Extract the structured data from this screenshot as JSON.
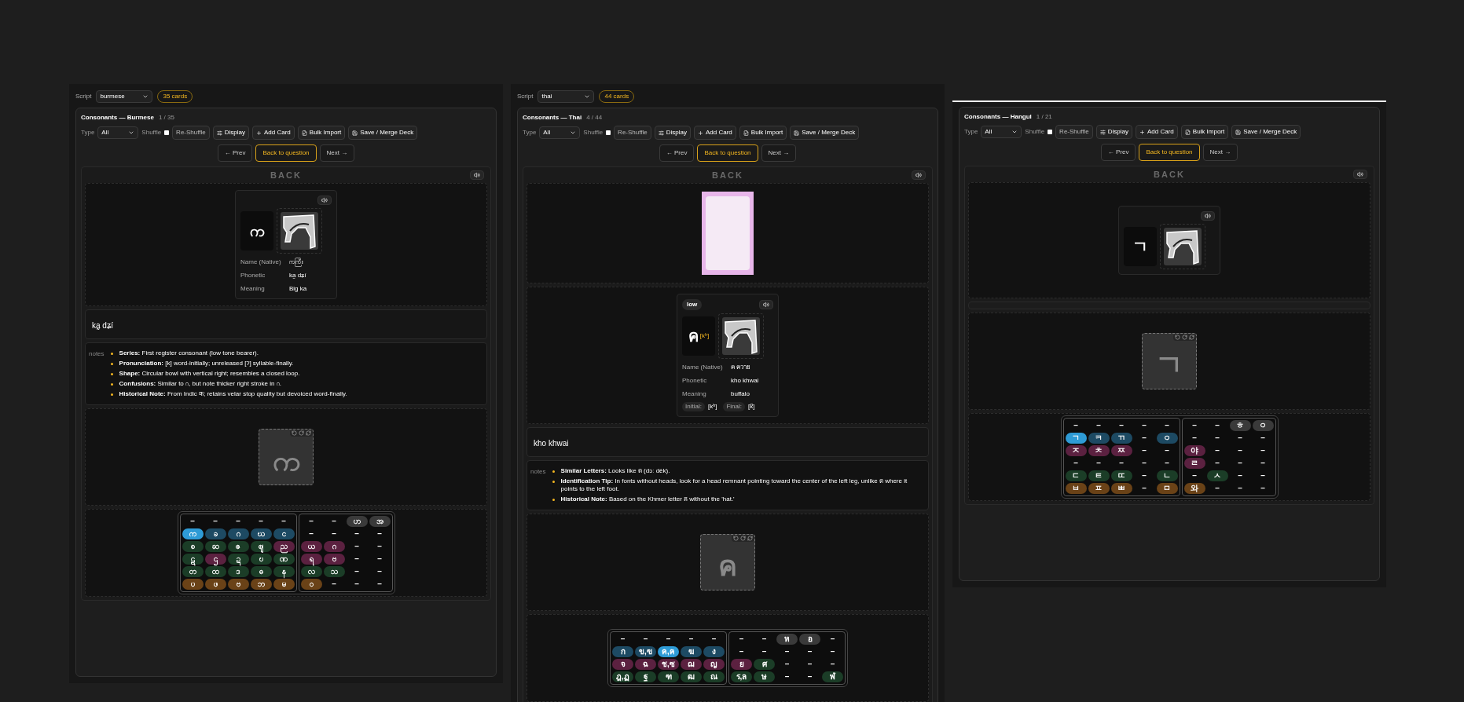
{
  "decks": [
    {
      "script": {
        "label": "Script",
        "value": "burmese",
        "count": "35 cards"
      },
      "title": "Consonants — Burmese",
      "position": "1 / 35",
      "toolbar": {
        "type_label": "Type",
        "type_value": "All",
        "shuffle_label": "Shuffle",
        "shuffle_checked": false,
        "buttons": [
          {
            "kind": "plain",
            "label": "Re-Shuffle"
          },
          {
            "kind": "display",
            "label": "Display"
          },
          {
            "kind": "add",
            "label": "Add Card"
          },
          {
            "kind": "import",
            "label": "Bulk Import"
          },
          {
            "kind": "save",
            "label": "Save / Merge Deck"
          }
        ]
      },
      "nav": [
        {
          "label": "← Prev",
          "selected": false
        },
        {
          "label": "Back to question",
          "selected": true
        },
        {
          "label": "Next →",
          "selected": false
        }
      ],
      "side_label": "BACK",
      "sections": [
        {
          "kind": "info",
          "letter": "က",
          "fields": [
            {
              "label": "Name (Native)",
              "value": "ကကြီး"
            },
            {
              "label": "Phonetic",
              "value": "ka̰ dʑí"
            },
            {
              "label": "Meaning",
              "value": "Big ka"
            }
          ]
        },
        {
          "kind": "phonetic",
          "text": "ka̰ dʑí"
        },
        {
          "kind": "notes",
          "label": "notes",
          "items": [
            "**Series:** First register consonant (low tone bearer).",
            "**Pronunciation:** [k] word-initially; unreleased [ʔ] syllable-finally.",
            "**Shape:** Circular bowl with vertical right; resembles a closed loop.",
            "**Confusions:** Similar to ဂ, but note thicker right stroke in ဂ.",
            "**Historical Note:** From Indic क; retains velar stop quality but devoiced word-finally."
          ]
        },
        {
          "kind": "trace",
          "glyph": "က"
        },
        {
          "kind": "grid",
          "groups": [
            {
              "rows": [
                [
                  {
                    "text": "–"
                  },
                  {
                    "text": "–"
                  },
                  {
                    "text": "–"
                  },
                  {
                    "text": "–"
                  },
                  {
                    "text": "–"
                  }
                ],
                [
                  {
                    "text": "က",
                    "color": "#2e9bd6"
                  },
                  {
                    "text": "ခ",
                    "color": "#1d4a63"
                  },
                  {
                    "text": "ဂ",
                    "color": "#1d4a63"
                  },
                  {
                    "text": "ဃ",
                    "color": "#1d4a63"
                  },
                  {
                    "text": "င",
                    "color": "#1d4a63"
                  }
                ],
                [
                  {
                    "text": "စ",
                    "color": "#1b3d27"
                  },
                  {
                    "text": "ဆ",
                    "color": "#1b3d27"
                  },
                  {
                    "text": "ဇ",
                    "color": "#1b3d27"
                  },
                  {
                    "text": "ဈ",
                    "color": "#1b3d27"
                  },
                  {
                    "text": "ည",
                    "color": "#5b2140"
                  }
                ],
                [
                  {
                    "text": "ဋ",
                    "color": "#1b3d27"
                  },
                  {
                    "text": "ဌ",
                    "color": "#5b2140"
                  },
                  {
                    "text": "ဍ",
                    "color": "#1b3d27"
                  },
                  {
                    "text": "ဎ",
                    "color": "#1b3d27"
                  },
                  {
                    "text": "ဏ",
                    "color": "#1b3d27"
                  }
                ],
                [
                  {
                    "text": "တ",
                    "color": "#1b3d27"
                  },
                  {
                    "text": "ထ",
                    "color": "#1b3d27"
                  },
                  {
                    "text": "ဒ",
                    "color": "#1b3d27"
                  },
                  {
                    "text": "ဓ",
                    "color": "#1b3d27"
                  },
                  {
                    "text": "န",
                    "color": "#1b3d27"
                  }
                ],
                [
                  {
                    "text": "ပ",
                    "color": "#6a4217"
                  },
                  {
                    "text": "ဖ",
                    "color": "#6a4217"
                  },
                  {
                    "text": "ဗ",
                    "color": "#6a4217"
                  },
                  {
                    "text": "ဘ",
                    "color": "#6a4217"
                  },
                  {
                    "text": "မ",
                    "color": "#6a4217"
                  }
                ]
              ]
            },
            {
              "rows": [
                [
                  {
                    "text": "–"
                  },
                  {
                    "text": "–"
                  },
                  {
                    "text": "ဟ",
                    "color": "#3a3a3a"
                  },
                  {
                    "text": "အ",
                    "color": "#3a3a3a"
                  }
                ],
                [
                  {
                    "text": "–"
                  },
                  {
                    "text": "–"
                  },
                  {
                    "text": "–"
                  },
                  {
                    "text": "–"
                  }
                ],
                [
                  {
                    "text": "ယ",
                    "color": "#5b2140"
                  },
                  {
                    "text": "ဂ",
                    "color": "#5b2140"
                  },
                  {
                    "text": "–"
                  },
                  {
                    "text": "–"
                  }
                ],
                [
                  {
                    "text": "ရ",
                    "color": "#5b2140"
                  },
                  {
                    "text": "ဗ",
                    "color": "#5b2140"
                  },
                  {
                    "text": "–"
                  },
                  {
                    "text": "–"
                  }
                ],
                [
                  {
                    "text": "လ",
                    "color": "#1b3d27"
                  },
                  {
                    "text": "သ",
                    "color": "#1b3d27"
                  },
                  {
                    "text": "–"
                  },
                  {
                    "text": "–"
                  }
                ],
                [
                  {
                    "text": "ဝ",
                    "color": "#6a4217"
                  },
                  {
                    "text": "–"
                  },
                  {
                    "text": "–"
                  },
                  {
                    "text": "–"
                  }
                ]
              ]
            }
          ]
        }
      ]
    },
    {
      "script": {
        "label": "Script",
        "value": "thai",
        "count": "44 cards"
      },
      "title": "Consonants — Thai",
      "position": "4 / 44",
      "toolbar": {
        "type_label": "Type",
        "type_value": "All",
        "shuffle_label": "Shuffle",
        "shuffle_checked": false,
        "buttons": [
          {
            "kind": "plain",
            "label": "Re-Shuffle"
          },
          {
            "kind": "display",
            "label": "Display"
          },
          {
            "kind": "add",
            "label": "Add Card"
          },
          {
            "kind": "import",
            "label": "Bulk Import"
          },
          {
            "kind": "save",
            "label": "Save / Merge Deck"
          }
        ]
      },
      "nav": [
        {
          "label": "← Prev",
          "selected": false
        },
        {
          "label": "Back to question",
          "selected": true
        },
        {
          "label": "Next →",
          "selected": false
        }
      ],
      "side_label": "BACK",
      "sections": [
        {
          "kind": "picture"
        },
        {
          "kind": "info",
          "tag": "low",
          "letter": "ค",
          "ipa": "[kʰ]",
          "fields": [
            {
              "label": "Name (Native)",
              "value": "ค ควาย"
            },
            {
              "label": "Phonetic",
              "value": "kho khwai"
            },
            {
              "label": "Meaning",
              "value": "buffalo"
            }
          ],
          "sounds": [
            {
              "label": "Initial:",
              "value": "[kʰ]"
            },
            {
              "label": "Final:",
              "value": "[k̚]"
            }
          ]
        },
        {
          "kind": "phonetic",
          "text": "kho khwai"
        },
        {
          "kind": "notes",
          "label": "notes",
          "items": [
            "**Similar Letters:** Looks like ด (dɔː dèk).",
            "**Identification Tip:** In fonts without heads, look for a head remnant pointing toward the center of the left leg, unlike ด where it points to the left foot.",
            "**Historical Note:** Based on the Khmer letter គ without the 'hat.'"
          ]
        },
        {
          "kind": "trace",
          "glyph": "ค"
        },
        {
          "kind": "grid",
          "groups": [
            {
              "rows": [
                [
                  {
                    "text": "–"
                  },
                  {
                    "text": "–"
                  },
                  {
                    "text": "–"
                  },
                  {
                    "text": "–"
                  },
                  {
                    "text": "–"
                  }
                ],
                [
                  {
                    "text": "ก",
                    "color": "#1d4a63"
                  },
                  {
                    "text": "ข,ฃ",
                    "color": "#1d4a63"
                  },
                  {
                    "text": "ค,ฅ",
                    "color": "#2e9bd6"
                  },
                  {
                    "text": "ฆ",
                    "color": "#1d4a63"
                  },
                  {
                    "text": "ง",
                    "color": "#1d4a63"
                  }
                ],
                [
                  {
                    "text": "จ",
                    "color": "#5b2140"
                  },
                  {
                    "text": "ฉ",
                    "color": "#5b2140"
                  },
                  {
                    "text": "ช,ซ",
                    "color": "#5b2140"
                  },
                  {
                    "text": "ฌ",
                    "color": "#5b2140"
                  },
                  {
                    "text": "ญ",
                    "color": "#5b2140"
                  }
                ],
                [
                  {
                    "text": "ฎ,ฏ",
                    "color": "#1b3d27"
                  },
                  {
                    "text": "ฐ",
                    "color": "#1b3d27"
                  },
                  {
                    "text": "ฑ",
                    "color": "#1b3d27"
                  },
                  {
                    "text": "ฒ",
                    "color": "#1b3d27"
                  },
                  {
                    "text": "ณ",
                    "color": "#1b3d27"
                  }
                ]
              ]
            },
            {
              "rows": [
                [
                  {
                    "text": "–"
                  },
                  {
                    "text": "–"
                  },
                  {
                    "text": "ห",
                    "color": "#3a3a3a"
                  },
                  {
                    "text": "อ",
                    "color": "#3a3a3a"
                  },
                  {
                    "text": "–"
                  }
                ],
                [
                  {
                    "text": "–"
                  },
                  {
                    "text": "–"
                  },
                  {
                    "text": "–"
                  },
                  {
                    "text": "–"
                  },
                  {
                    "text": "–"
                  }
                ],
                [
                  {
                    "text": "ย",
                    "color": "#5b2140"
                  },
                  {
                    "text": "ศ",
                    "color": "#1b3d27"
                  },
                  {
                    "text": "–"
                  },
                  {
                    "text": "–"
                  },
                  {
                    "text": "–"
                  }
                ],
                [
                  {
                    "text": "ร,ล",
                    "color": "#1b3d27"
                  },
                  {
                    "text": "ษ",
                    "color": "#1b3d27"
                  },
                  {
                    "text": "–"
                  },
                  {
                    "text": "–"
                  },
                  {
                    "text": "ฬ",
                    "color": "#1b3d27"
                  }
                ]
              ]
            }
          ]
        }
      ]
    },
    {
      "title": "Consonants — Hangul",
      "position": "1 / 21",
      "toolbar": {
        "type_label": "Type",
        "type_value": "All",
        "shuffle_label": "Shuffle",
        "shuffle_checked": false,
        "buttons": [
          {
            "kind": "plain",
            "label": "Re-Shuffle"
          },
          {
            "kind": "display",
            "label": "Display"
          },
          {
            "kind": "add",
            "label": "Add Card"
          },
          {
            "kind": "import",
            "label": "Bulk Import"
          },
          {
            "kind": "save",
            "label": "Save / Merge Deck"
          }
        ]
      },
      "nav": [
        {
          "label": "← Prev",
          "selected": false
        },
        {
          "label": "Back to question",
          "selected": true
        },
        {
          "label": "Next →",
          "selected": false
        }
      ],
      "side_label": "BACK",
      "sections": [
        {
          "kind": "info",
          "letter": "ㄱ"
        },
        {
          "kind": "blank"
        },
        {
          "kind": "trace",
          "glyph": "ㄱ"
        },
        {
          "kind": "grid",
          "groups": [
            {
              "rows": [
                [
                  {
                    "text": "–"
                  },
                  {
                    "text": "–"
                  },
                  {
                    "text": "–"
                  },
                  {
                    "text": "–"
                  },
                  {
                    "text": "–"
                  }
                ],
                [
                  {
                    "text": "ㄱ",
                    "color": "#2e9bd6"
                  },
                  {
                    "text": "ㅋ",
                    "color": "#1d4a63"
                  },
                  {
                    "text": "ㄲ",
                    "color": "#1d4a63"
                  },
                  {
                    "text": "–"
                  },
                  {
                    "text": "ㅇ",
                    "color": "#1d4a63"
                  }
                ],
                [
                  {
                    "text": "ㅈ",
                    "color": "#5b2140"
                  },
                  {
                    "text": "ㅊ",
                    "color": "#5b2140"
                  },
                  {
                    "text": "ㅉ",
                    "color": "#5b2140"
                  },
                  {
                    "text": "–"
                  },
                  {
                    "text": "–"
                  }
                ],
                [
                  {
                    "text": "–"
                  },
                  {
                    "text": "–"
                  },
                  {
                    "text": "–"
                  },
                  {
                    "text": "–"
                  },
                  {
                    "text": "–"
                  }
                ],
                [
                  {
                    "text": "ㄷ",
                    "color": "#1b3d27"
                  },
                  {
                    "text": "ㅌ",
                    "color": "#1b3d27"
                  },
                  {
                    "text": "ㄸ",
                    "color": "#1b3d27"
                  },
                  {
                    "text": "–"
                  },
                  {
                    "text": "ㄴ",
                    "color": "#1b3d27"
                  }
                ],
                [
                  {
                    "text": "ㅂ",
                    "color": "#6a4217"
                  },
                  {
                    "text": "ㅍ",
                    "color": "#6a4217"
                  },
                  {
                    "text": "ㅃ",
                    "color": "#6a4217"
                  },
                  {
                    "text": "–"
                  },
                  {
                    "text": "ㅁ",
                    "color": "#6a4217"
                  }
                ]
              ]
            },
            {
              "rows": [
                [
                  {
                    "text": "–"
                  },
                  {
                    "text": "–"
                  },
                  {
                    "text": "ㅎ",
                    "color": "#3a3a3a"
                  },
                  {
                    "text": "ㅇ",
                    "color": "#3a3a3a"
                  }
                ],
                [
                  {
                    "text": "–"
                  },
                  {
                    "text": "–"
                  },
                  {
                    "text": "–"
                  },
                  {
                    "text": "–"
                  }
                ],
                [
                  {
                    "text": "야",
                    "color": "#5b2140"
                  },
                  {
                    "text": "–"
                  },
                  {
                    "text": "–"
                  },
                  {
                    "text": "–"
                  }
                ],
                [
                  {
                    "text": "ㄹ",
                    "color": "#5b2140"
                  },
                  {
                    "text": "–"
                  },
                  {
                    "text": "–"
                  },
                  {
                    "text": "–"
                  }
                ],
                [
                  {
                    "text": "–"
                  },
                  {
                    "text": "ㅅ",
                    "color": "#1b3d27"
                  },
                  {
                    "text": "–"
                  },
                  {
                    "text": "–"
                  }
                ],
                [
                  {
                    "text": "와",
                    "color": "#6a4217"
                  },
                  {
                    "text": "–"
                  },
                  {
                    "text": "–"
                  },
                  {
                    "text": "–"
                  }
                ]
              ]
            }
          ]
        }
      ]
    }
  ]
}
